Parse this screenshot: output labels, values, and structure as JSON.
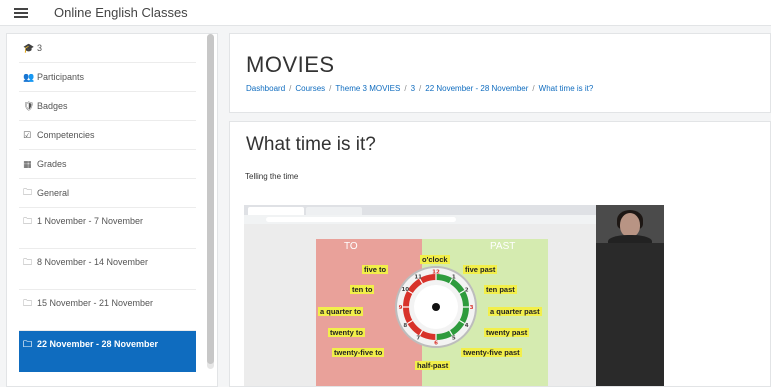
{
  "header": {
    "site_name": "Online English Classes",
    "menu_icon": "hamburger-menu-icon"
  },
  "drawer": {
    "items": [
      {
        "icon": "graduation-cap-icon",
        "glyph": "🎓",
        "label": "3"
      },
      {
        "icon": "participants-icon",
        "glyph": "👥",
        "label": "Participants"
      },
      {
        "icon": "badge-icon",
        "glyph": "🛡",
        "label": "Badges"
      },
      {
        "icon": "competencies-icon",
        "glyph": "☑",
        "label": "Competencies"
      },
      {
        "icon": "grades-icon",
        "glyph": "▦",
        "label": "Grades"
      },
      {
        "icon": "folder-icon",
        "glyph": "🗀",
        "label": "General"
      },
      {
        "icon": "folder-icon",
        "glyph": "🗀",
        "label": "1 November - 7 November"
      },
      {
        "icon": "folder-icon",
        "glyph": "🗀",
        "label": "8 November - 14 November"
      },
      {
        "icon": "folder-icon",
        "glyph": "🗀",
        "label": "15 November - 21 November"
      },
      {
        "icon": "folder-icon",
        "glyph": "🗀",
        "label": "22 November - 28 November"
      }
    ],
    "active_index": 9
  },
  "course": {
    "title": "MOVIES",
    "breadcrumb": [
      "Dashboard",
      "Courses",
      "Theme 3 MOVIES",
      "3",
      "22 November - 28 November",
      "What time is it?"
    ]
  },
  "page": {
    "heading": "What time is it?",
    "intro": "Telling the time"
  },
  "video_slide": {
    "to_label": "TO",
    "past_label": "PAST",
    "oclock": "o'clock",
    "five_to": "five to",
    "five_past": "five past",
    "ten_to": "ten to",
    "ten_past": "ten past",
    "quarter_to": "a quarter to",
    "quarter_past": "a quarter past",
    "twenty_to": "twenty to",
    "twenty_past": "twenty past",
    "twenty_five_to": "twenty-five to",
    "twenty_five_past": "twenty-five past",
    "half_past": "half-past",
    "clock_numbers": [
      "12",
      "1",
      "2",
      "3",
      "4",
      "5",
      "6",
      "7",
      "8",
      "9",
      "10",
      "11"
    ],
    "colors": {
      "to": "#d8322a",
      "past": "#2e9b3d",
      "label_bg": "#f2ef4a"
    }
  },
  "colors": {
    "accent": "#0f6cbf",
    "page_bg": "#f4f5f6"
  }
}
